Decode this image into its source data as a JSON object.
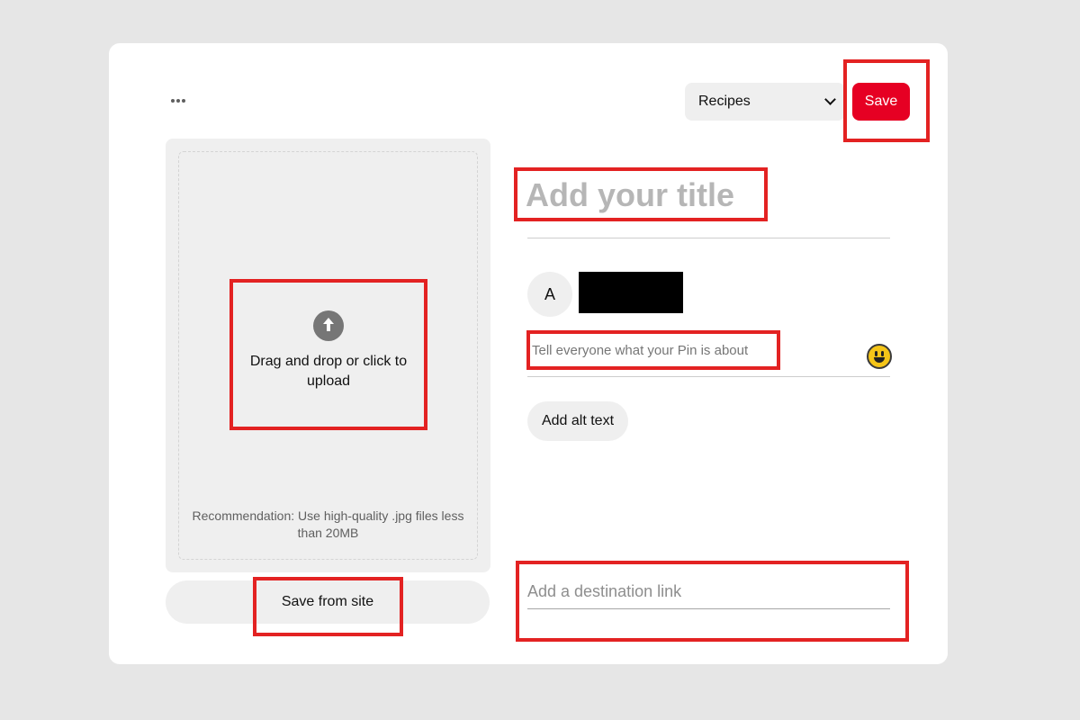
{
  "header": {
    "more_icon": "more-horizontal-icon",
    "board_select": {
      "value": "Recipes",
      "icon": "chevron-down-icon"
    },
    "save_label": "Save"
  },
  "upload": {
    "icon": "upload-arrow-icon",
    "label": "Drag and drop or click to upload",
    "hint": "Recommendation: Use high-quality .jpg files less than 20MB",
    "save_from_site_label": "Save from site"
  },
  "form": {
    "title_placeholder": "Add your title",
    "user": {
      "avatar_initial": "A",
      "name_redacted": true
    },
    "description_placeholder": "Tell everyone what your Pin is about",
    "emoji_icon": "emoji-picker-icon",
    "alt_text_label": "Add alt text",
    "link_placeholder": "Add a destination link"
  },
  "colors": {
    "page_bg": "#e6e6e6",
    "card_bg": "#ffffff",
    "brand_red": "#e60023",
    "panel_gray": "#efefef",
    "highlight_box": "#e32222"
  }
}
